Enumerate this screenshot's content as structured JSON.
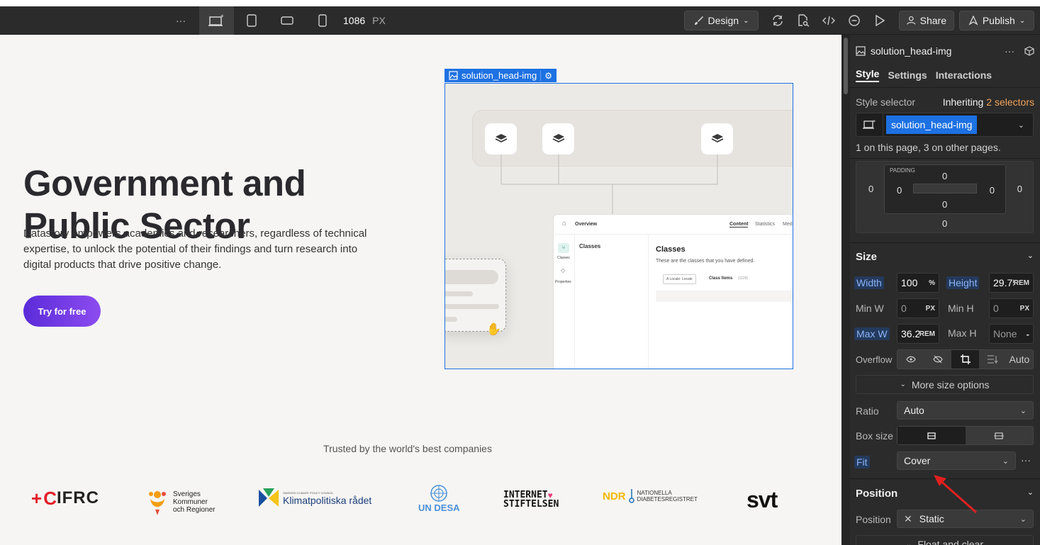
{
  "topbar": {
    "more": "···",
    "width_value": "1086",
    "width_unit": "PX",
    "design_label": "Design",
    "share_label": "Share",
    "publish_label": "Publish"
  },
  "hero": {
    "title": "Government and Public Sector",
    "description": "Datastory empowers academics and researchers, regardless of technical expertise, to unlock the potential of their findings and turn research into digital products that drive positive change.",
    "cta": "Try for free"
  },
  "selection": {
    "label": "solution_head-img"
  },
  "mock_ui": {
    "overview": "Overview",
    "tabs": [
      "Content",
      "Statistics",
      "Med"
    ],
    "side_items": [
      "Classes",
      "Properties"
    ],
    "col_title": "Classes",
    "main_title": "Classes",
    "main_sub": "These are the classes that you have defined.",
    "locale_chip": "Locale: Locale",
    "class_items": "Class Items",
    "class_count": "(1129)"
  },
  "trusted": {
    "heading": "Trusted by the world's best companies",
    "logos": {
      "ifrc": "IFRC",
      "skr_line1": "Sveriges",
      "skr_line2": "Kommuner",
      "skr_line3": "och Regioner",
      "klimat_small": "SWEDISH CLIMATE POLICY COUNCIL",
      "klimat": "Klimatpolitiska rådet",
      "undesa": "UN DESA",
      "internet_1": "INTERNET",
      "internet_2": "STIFTELSEN",
      "ndr": "NDR",
      "ndr_1": "NATIONELLA",
      "ndr_2": "DIABETESREGISTRET",
      "svt": "svt"
    }
  },
  "panel": {
    "element_name": "solution_head-img",
    "tabs": {
      "style": "Style",
      "settings": "Settings",
      "interactions": "Interactions"
    },
    "style_selector_label": "Style selector",
    "inheriting": "Inheriting",
    "selectors_count": "2 selectors",
    "selector_chip": "solution_head-img",
    "usage_note": "1 on this page, 3 on other pages.",
    "spacing": {
      "padding_label": "PADDING",
      "margin_left": "0",
      "margin_right": "0",
      "margin_bottom": "0",
      "pad_top": "0",
      "pad_left": "0",
      "pad_right": "0",
      "pad_bottom": "0"
    },
    "size": {
      "title": "Size",
      "width_label": "Width",
      "width_value": "100",
      "width_unit": "%",
      "height_label": "Height",
      "height_value": "29.75",
      "height_unit": "REM",
      "minw_label": "Min W",
      "minw_value": "0",
      "minw_unit": "PX",
      "minh_label": "Min H",
      "minh_value": "0",
      "minh_unit": "PX",
      "maxw_label": "Max W",
      "maxw_value": "36.25",
      "maxw_unit": "REM",
      "maxh_label": "Max H",
      "maxh_value": "None",
      "maxh_unit": "-",
      "overflow_label": "Overflow",
      "overflow_auto": "Auto",
      "more_options": "More size options",
      "ratio_label": "Ratio",
      "ratio_value": "Auto",
      "boxsize_label": "Box size",
      "fit_label": "Fit",
      "fit_value": "Cover"
    },
    "position": {
      "title": "Position",
      "position_label": "Position",
      "position_value": "Static",
      "float_clear": "Float and clear"
    }
  },
  "colors": {
    "accent": "#1d71e2",
    "cta_start": "#5b2bd9",
    "cta_end": "#8c4cf0",
    "annotation": "#e02020"
  }
}
